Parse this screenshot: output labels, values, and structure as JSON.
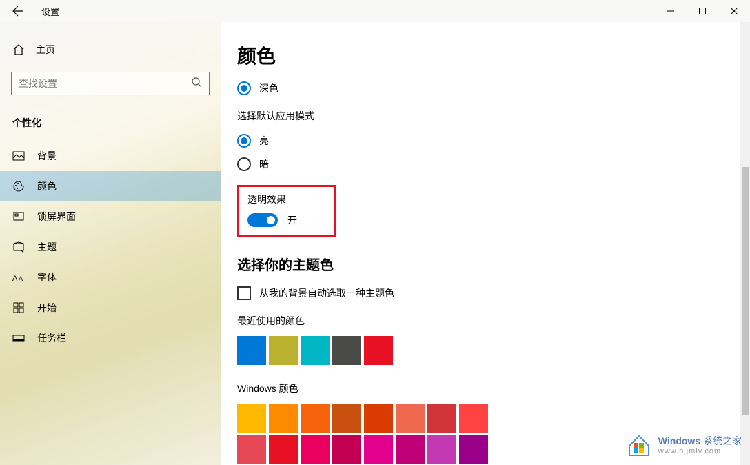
{
  "titlebar": {
    "title": "设置"
  },
  "sidebar": {
    "home": "主页",
    "search_placeholder": "查找设置",
    "section": "个性化",
    "items": [
      {
        "icon": "background-icon",
        "label": "背景"
      },
      {
        "icon": "colors-icon",
        "label": "颜色"
      },
      {
        "icon": "lockscreen-icon",
        "label": "锁屏界面"
      },
      {
        "icon": "themes-icon",
        "label": "主题"
      },
      {
        "icon": "fonts-icon",
        "label": "字体"
      },
      {
        "icon": "start-icon",
        "label": "开始"
      },
      {
        "icon": "taskbar-icon",
        "label": "任务栏"
      }
    ]
  },
  "content": {
    "title": "颜色",
    "windows_mode": {
      "options": [
        {
          "label": "深色",
          "selected": true
        }
      ]
    },
    "app_mode": {
      "label": "选择默认应用模式",
      "options": [
        {
          "label": "亮",
          "selected": true
        },
        {
          "label": "暗",
          "selected": false
        }
      ]
    },
    "transparency": {
      "label": "透明效果",
      "state": "开",
      "on": true
    },
    "accent": {
      "title": "选择你的主题色",
      "auto_checkbox": "从我的背景自动选取一种主题色",
      "recent_label": "最近使用的颜色",
      "recent_colors": [
        "#0078d7",
        "#bab22e",
        "#00b7c3",
        "#4a4a48",
        "#e81123"
      ],
      "windows_label": "Windows 颜色",
      "windows_colors": [
        [
          "#ffb900",
          "#ff8c00",
          "#f7630c",
          "#ca5010",
          "#da3b01",
          "#ef6950",
          "#d13438",
          "#ff4343"
        ],
        [
          "#e74856",
          "#e81123",
          "#ea005e",
          "#c30052",
          "#e3008c",
          "#bf0077",
          "#c239b3",
          "#9a0089"
        ]
      ]
    }
  },
  "watermark": {
    "brand": "Windows",
    "suffix": "系统之家",
    "url": "www.bjjmlv.com"
  }
}
